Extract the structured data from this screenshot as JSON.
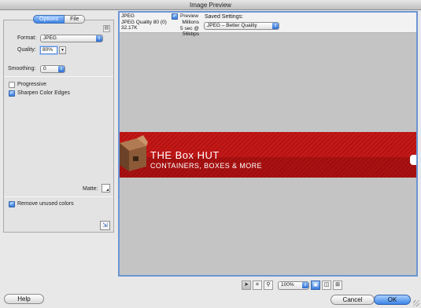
{
  "window": {
    "title": "Image Preview"
  },
  "tabs": [
    {
      "label": "Options"
    },
    {
      "label": "File"
    }
  ],
  "options": {
    "format_label": "Format:",
    "format_value": "JPEG",
    "quality_label": "Quality:",
    "quality_value": "80%",
    "smoothing_label": "Smoothing:",
    "smoothing_value": "0",
    "progressive_label": "Progressive",
    "progressive_checked": false,
    "sharpen_label": "Sharpen Color Edges",
    "sharpen_checked": true,
    "matte_label": "Matte:",
    "remove_unused_label": "Remove unused colors",
    "remove_unused_checked": true
  },
  "preview_info": {
    "format": "JPEG",
    "quality_line": "JPEG Quality 80 (0)",
    "size": "32.17K",
    "preview_label": "Preview",
    "preview_checked": true,
    "colors": "Millions",
    "download_time": "5 sec @ 56kbps",
    "saved_settings_label": "Saved Settings:",
    "saved_settings_value": "JPEG – Better Quality"
  },
  "banner": {
    "title": "THE Box HUT",
    "subtitle": "CONTAINERS, BOXES & MORE",
    "color": "#c51a1a"
  },
  "toolbar": {
    "tools": [
      "pointer-icon",
      "crop-icon",
      "zoom-icon"
    ],
    "zoom_value": "100%",
    "views": [
      "single-view-icon",
      "two-view-icon",
      "four-view-icon"
    ]
  },
  "buttons": {
    "help": "Help",
    "cancel": "Cancel",
    "ok": "OK"
  }
}
